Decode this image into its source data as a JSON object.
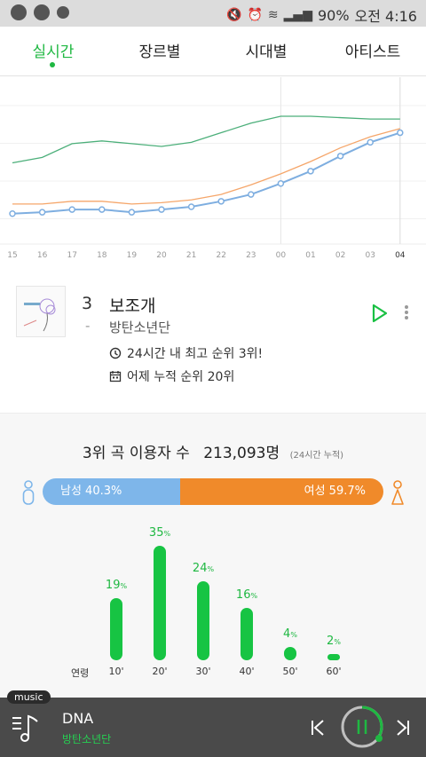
{
  "status_bar": {
    "battery": "90%",
    "time": "오전 4:16",
    "left_icons": [
      "notification-icon",
      "cloud-icon",
      "sync-icon"
    ],
    "right_icons": [
      "mute-icon",
      "alarm-icon",
      "wifi-icon",
      "signal-icon"
    ]
  },
  "tabs": [
    {
      "label": "실시간",
      "active": true
    },
    {
      "label": "장르별",
      "active": false
    },
    {
      "label": "시대별",
      "active": false
    },
    {
      "label": "아티스트",
      "active": false
    }
  ],
  "chart_data": {
    "type": "line",
    "x": [
      "15",
      "16",
      "17",
      "18",
      "19",
      "20",
      "21",
      "22",
      "23",
      "00",
      "01",
      "02",
      "03",
      "04"
    ],
    "current_x": "04",
    "series": [
      {
        "color": "#4caf7a",
        "values": [
          5.4,
          5.8,
          6.8,
          7.0,
          6.8,
          6.6,
          6.9,
          7.6,
          8.3,
          8.8,
          8.8,
          8.7,
          8.6,
          8.6
        ]
      },
      {
        "color": "#f5a66a",
        "values": [
          2.4,
          2.4,
          2.6,
          2.6,
          2.4,
          2.5,
          2.7,
          3.1,
          3.8,
          4.6,
          5.5,
          6.5,
          7.3,
          7.9
        ]
      },
      {
        "color": "#7eaee0",
        "markers": true,
        "values": [
          1.7,
          1.8,
          2.0,
          2.0,
          1.8,
          2.0,
          2.2,
          2.6,
          3.1,
          3.9,
          4.8,
          5.9,
          6.9,
          7.6
        ]
      }
    ],
    "grid": "horizontal"
  },
  "song": {
    "rank": "3",
    "rank_change": "-",
    "title": "보조개",
    "artist": "방탄소년단",
    "peak_text": "24시간 내 최고 순위 3위!",
    "cumulative_text": "어제 누적 순위 20위"
  },
  "listeners": {
    "label": "3위 곡 이용자 수",
    "count": "213,093명",
    "note": "(24시간 누적)"
  },
  "gender": {
    "male_label": "남성 40.3%",
    "male_pct": 40.3,
    "female_label": "여성 59.7%",
    "female_pct": 59.7,
    "male_color": "#7eb6ea",
    "female_color": "#f08a2a"
  },
  "age": {
    "axis_label": "연령",
    "groups": [
      {
        "label": "10'",
        "value": 19
      },
      {
        "label": "20'",
        "value": 35
      },
      {
        "label": "30'",
        "value": 24
      },
      {
        "label": "40'",
        "value": 16
      },
      {
        "label": "50'",
        "value": 4
      },
      {
        "label": "60'",
        "value": 2
      }
    ],
    "unit": "%"
  },
  "player": {
    "tag": "music",
    "title": "DNA",
    "artist": "방탄소년단"
  }
}
